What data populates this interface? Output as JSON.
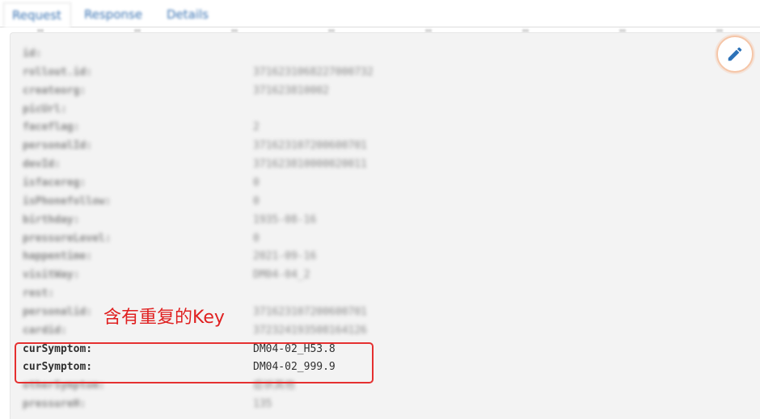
{
  "tabs": [
    {
      "label": "Request",
      "active": true
    },
    {
      "label": "Response",
      "active": false
    },
    {
      "label": "Details",
      "active": false
    }
  ],
  "rows": [
    {
      "key": "id:",
      "value": ""
    },
    {
      "key": "rollout.id:",
      "value": "3716231068227000732"
    },
    {
      "key": "createorg:",
      "value": "371623810002"
    },
    {
      "key": "picUrl:",
      "value": ""
    },
    {
      "key": "faceflag:",
      "value": "2"
    },
    {
      "key": "personalId:",
      "value": "371623107200600701"
    },
    {
      "key": "devId:",
      "value": "371623810000020011"
    },
    {
      "key": "isfacereg:",
      "value": "0"
    },
    {
      "key": "isPhonefollow:",
      "value": "0"
    },
    {
      "key": "birthday:",
      "value": "1935-08-16"
    },
    {
      "key": "pressureLevel:",
      "value": "0"
    },
    {
      "key": "happentime:",
      "value": "2021-09-16"
    },
    {
      "key": "visitWay:",
      "value": "DM04-04_2"
    },
    {
      "key": "rest:",
      "value": ""
    },
    {
      "key": "personalid:",
      "value": "371623107200600701"
    },
    {
      "key": "cardid:",
      "value": "372324193508164126"
    },
    {
      "key": "curSymptom:",
      "value": "DM04-02_H53.8"
    },
    {
      "key": "curSymptom:",
      "value": "DM04-02_999.9"
    },
    {
      "key": "otherSymptom:",
      "value": "症状其他"
    },
    {
      "key": "pressureH:",
      "value": "135"
    }
  ],
  "annotation": {
    "text": "含有重复的Key",
    "color": "#e02020"
  },
  "highlight": {
    "color": "#e53030"
  },
  "edit_button": {
    "icon": "pencil-icon",
    "color": "#2d72b8"
  }
}
